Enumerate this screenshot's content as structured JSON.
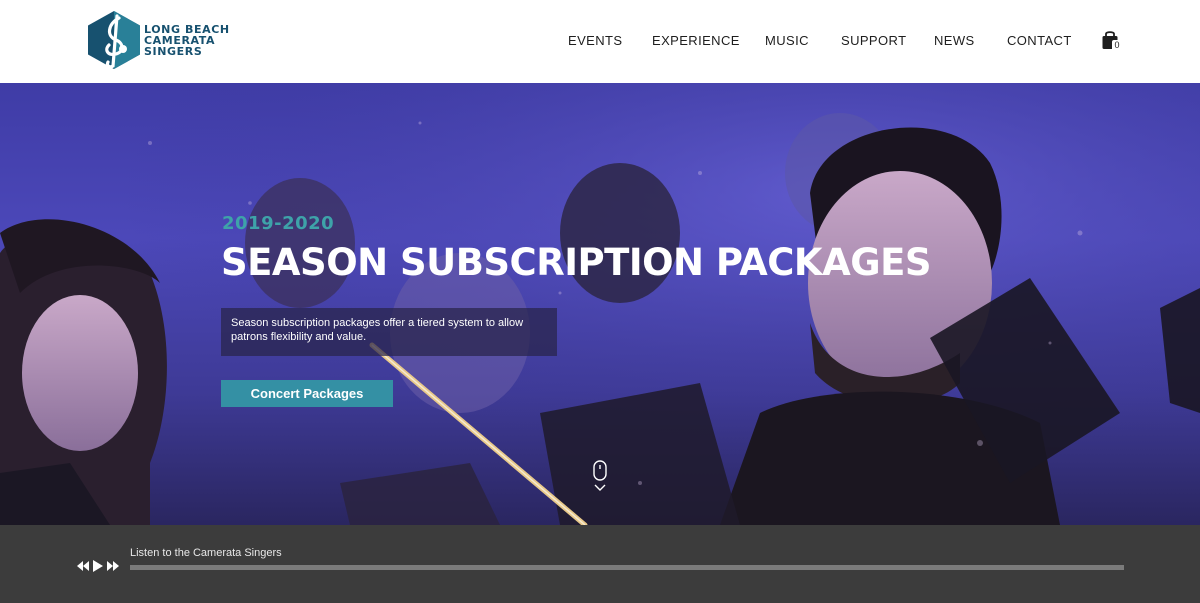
{
  "brand": {
    "line1": "LONG BEACH",
    "line2": "CAMERATA",
    "line3": "SINGERS",
    "logo_icon": "treble-clef-hexagon-icon",
    "colors": {
      "primary": "#17516f",
      "accent": "#3490a4"
    }
  },
  "nav": {
    "items": [
      "EVENTS",
      "EXPERIENCE",
      "MUSIC",
      "SUPPORT",
      "NEWS",
      "CONTACT"
    ],
    "cart_icon": "shopping-bag-icon",
    "cart_count": "0"
  },
  "hero": {
    "year": "2019-2020",
    "title": "SEASON SUBSCRIPTION PACKAGES",
    "description": "Season subscription packages offer a tiered system to allow patrons flexibility and value.",
    "cta_label": "Concert Packages",
    "scroll_icon": "mouse-scroll-icon",
    "colors": {
      "year": "#3ea3a9",
      "cta": "#3490a4",
      "overlay": "#4c48b9"
    }
  },
  "player": {
    "track_title": "Listen to the Camerata Singers",
    "controls": [
      "rewind-icon",
      "play-icon",
      "fast-forward-icon"
    ],
    "progress": 0
  }
}
